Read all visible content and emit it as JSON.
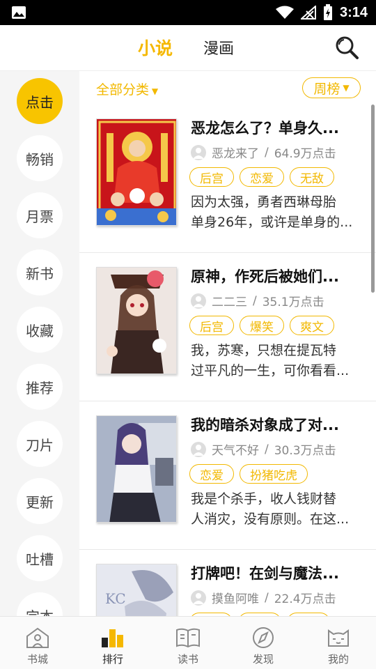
{
  "status_bar": {
    "time": "3:14"
  },
  "top_tabs": [
    {
      "label": "小说",
      "active": true
    },
    {
      "label": "漫画",
      "active": false
    }
  ],
  "sidebar": {
    "items": [
      {
        "label": "点击",
        "active": true
      },
      {
        "label": "畅销"
      },
      {
        "label": "月票"
      },
      {
        "label": "新书"
      },
      {
        "label": "收藏"
      },
      {
        "label": "推荐"
      },
      {
        "label": "刀片"
      },
      {
        "label": "更新"
      },
      {
        "label": "吐槽"
      },
      {
        "label": "完本"
      }
    ]
  },
  "filters": {
    "category": "全部分类",
    "period": "周榜"
  },
  "books": [
    {
      "title": "恶龙怎么了？单身久...",
      "author": "恶龙来了",
      "clicks": "64.9万点击",
      "tags": [
        "后宫",
        "恋爱",
        "无敌"
      ],
      "desc_line1": "因为太强，勇者西琳母胎",
      "desc_line2": "单身26年，或许是单身的..."
    },
    {
      "title": "原神，作死后被她们...",
      "author": "二二三",
      "clicks": "35.1万点击",
      "tags": [
        "后宫",
        "爆笑",
        "爽文"
      ],
      "desc_line1": "我，苏寒，只想在提瓦特",
      "desc_line2": "过平凡的一生，可你看看..."
    },
    {
      "title": "我的暗杀对象成了对...",
      "author": "天气不好",
      "clicks": "30.3万点击",
      "tags": [
        "恋爱",
        "扮猪吃虎"
      ],
      "desc_line1": "我是个杀手，收人钱财替",
      "desc_line2": "人消灾，没有原则。在这..."
    },
    {
      "title": "打牌吧！在剑与魔法...",
      "author": "摸鱼阿唯",
      "clicks": "22.4万点击",
      "tags": [
        "",
        "",
        ""
      ],
      "desc_line1": "",
      "desc_line2": ""
    }
  ],
  "bottom_nav": [
    {
      "label": "书城",
      "icon": "house-icon"
    },
    {
      "label": "排行",
      "icon": "bar-chart-icon",
      "active": true
    },
    {
      "label": "读书",
      "icon": "book-icon"
    },
    {
      "label": "发现",
      "icon": "compass-icon"
    },
    {
      "label": "我的",
      "icon": "cat-face-icon"
    }
  ],
  "colors": {
    "accent": "#f5b800",
    "sidebar_bg": "#f5f5f5"
  }
}
